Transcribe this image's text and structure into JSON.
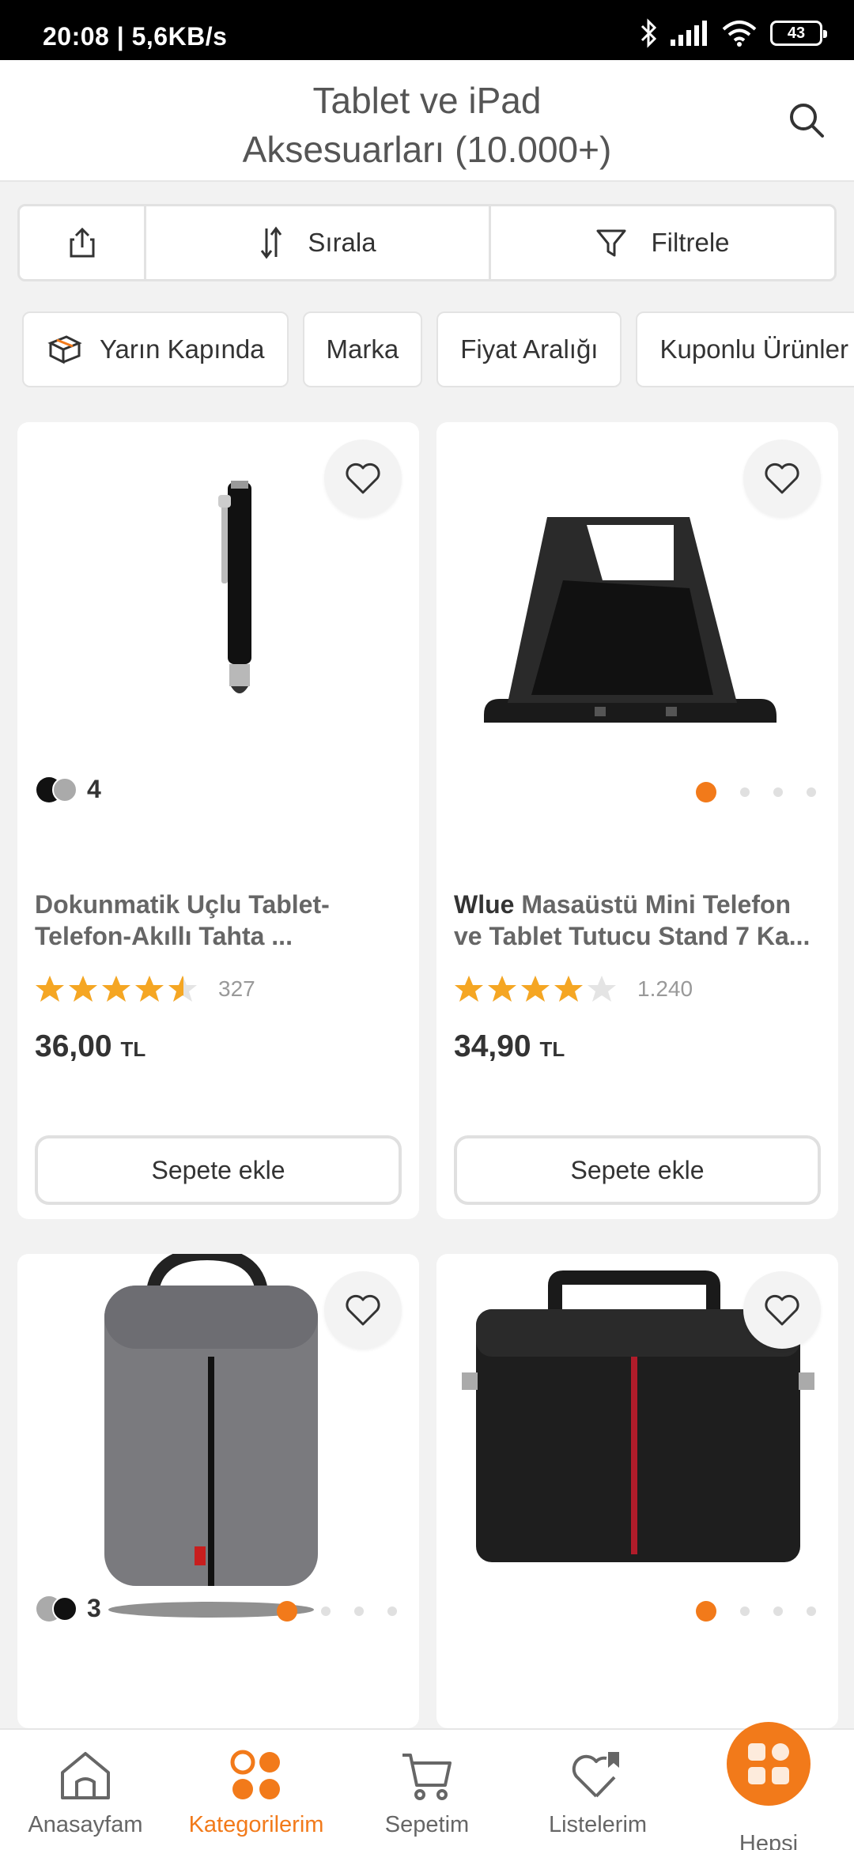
{
  "status_bar": {
    "time": "20:08 | 5,6KB/s",
    "battery": "43"
  },
  "header": {
    "title_line1": "Tablet ve iPad",
    "title_line2": "Aksesuarları (10.000+)"
  },
  "toolbar": {
    "sort_label": "Sırala",
    "filter_label": "Filtrele"
  },
  "chips": [
    {
      "label": "Yarın Kapında"
    },
    {
      "label": "Marka"
    },
    {
      "label": "Fiyat Aralığı"
    },
    {
      "label": "Kuponlu Ürünler"
    }
  ],
  "products": [
    {
      "brand": "",
      "name": "Dokunmatik Uçlu Tablet-Telefon-Akıllı Tahta ...",
      "rating": 4.5,
      "review_count": "327",
      "price": "36,00",
      "currency": "TL",
      "variant_count": "4",
      "add_to_cart": "Sepete ekle"
    },
    {
      "brand": "Wlue",
      "name": "Masaüstü Mini Telefon ve Tablet Tutucu Stand 7 Ka...",
      "rating": 4,
      "review_count": "1.240",
      "price": "34,90",
      "currency": "TL",
      "add_to_cart": "Sepete ekle"
    },
    {
      "variant_count": "3"
    },
    {}
  ],
  "bottom_nav": [
    {
      "label": "Anasayfam"
    },
    {
      "label": "Kategorilerim",
      "active": true
    },
    {
      "label": "Sepetim"
    },
    {
      "label": "Listelerim"
    },
    {
      "label": "Hepsi"
    }
  ],
  "colors": {
    "accent": "#f27a1a",
    "star": "#f5a623"
  }
}
